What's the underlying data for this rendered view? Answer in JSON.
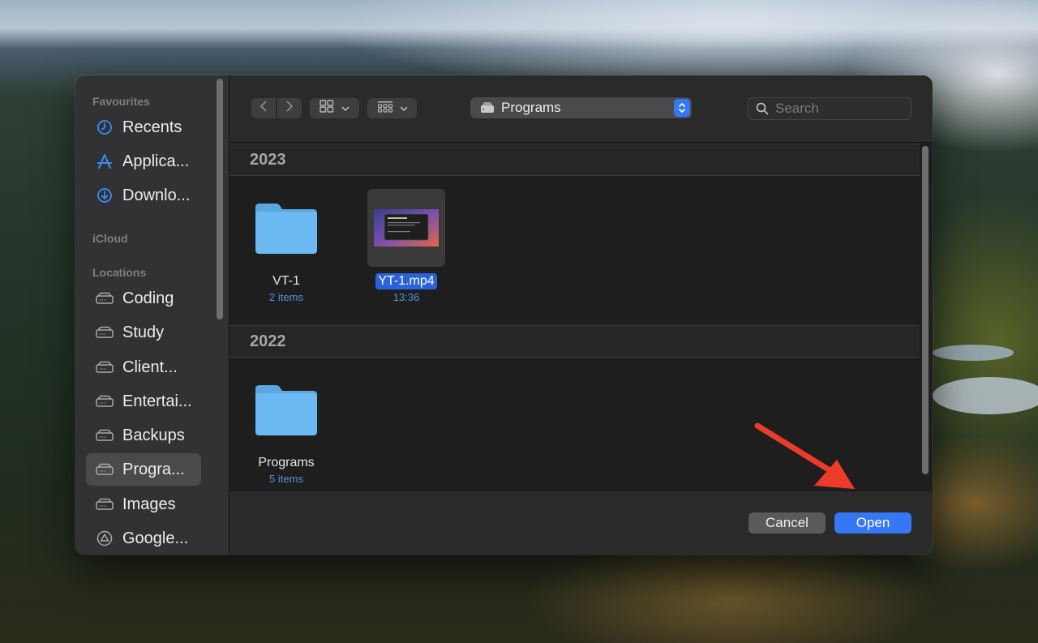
{
  "sidebar": {
    "sections": {
      "favourites": "Favourites",
      "icloud": "iCloud",
      "locations": "Locations"
    },
    "favourites": [
      {
        "label": "Recents",
        "icon": "clock-icon"
      },
      {
        "label": "Applica...",
        "icon": "applications-icon"
      },
      {
        "label": "Downlo...",
        "icon": "download-icon"
      }
    ],
    "locations": [
      {
        "label": "Coding",
        "icon": "drive-icon"
      },
      {
        "label": "Study",
        "icon": "drive-icon"
      },
      {
        "label": "Client...",
        "icon": "drive-icon"
      },
      {
        "label": "Entertai...",
        "icon": "drive-icon"
      },
      {
        "label": "Backups",
        "icon": "drive-icon"
      },
      {
        "label": "Progra...",
        "icon": "drive-icon",
        "selected": true
      },
      {
        "label": "Images",
        "icon": "drive-icon"
      },
      {
        "label": "Google...",
        "icon": "google-drive-icon"
      }
    ]
  },
  "toolbar": {
    "location": "Programs",
    "search_placeholder": "Search"
  },
  "groups": [
    {
      "title": "2023",
      "items": [
        {
          "name": "VT-1",
          "sub": "2 items",
          "type": "folder"
        },
        {
          "name": "YT-1.mp4",
          "sub": "13:36",
          "type": "video",
          "selected": true
        }
      ]
    },
    {
      "title": "2022",
      "items": [
        {
          "name": "Programs",
          "sub": "5 items",
          "type": "folder"
        }
      ]
    }
  ],
  "footer": {
    "cancel": "Cancel",
    "open": "Open"
  },
  "colors": {
    "accent": "#3478f6",
    "folder": "#6cb8f0",
    "annotation_arrow": "#ec3b2a"
  }
}
